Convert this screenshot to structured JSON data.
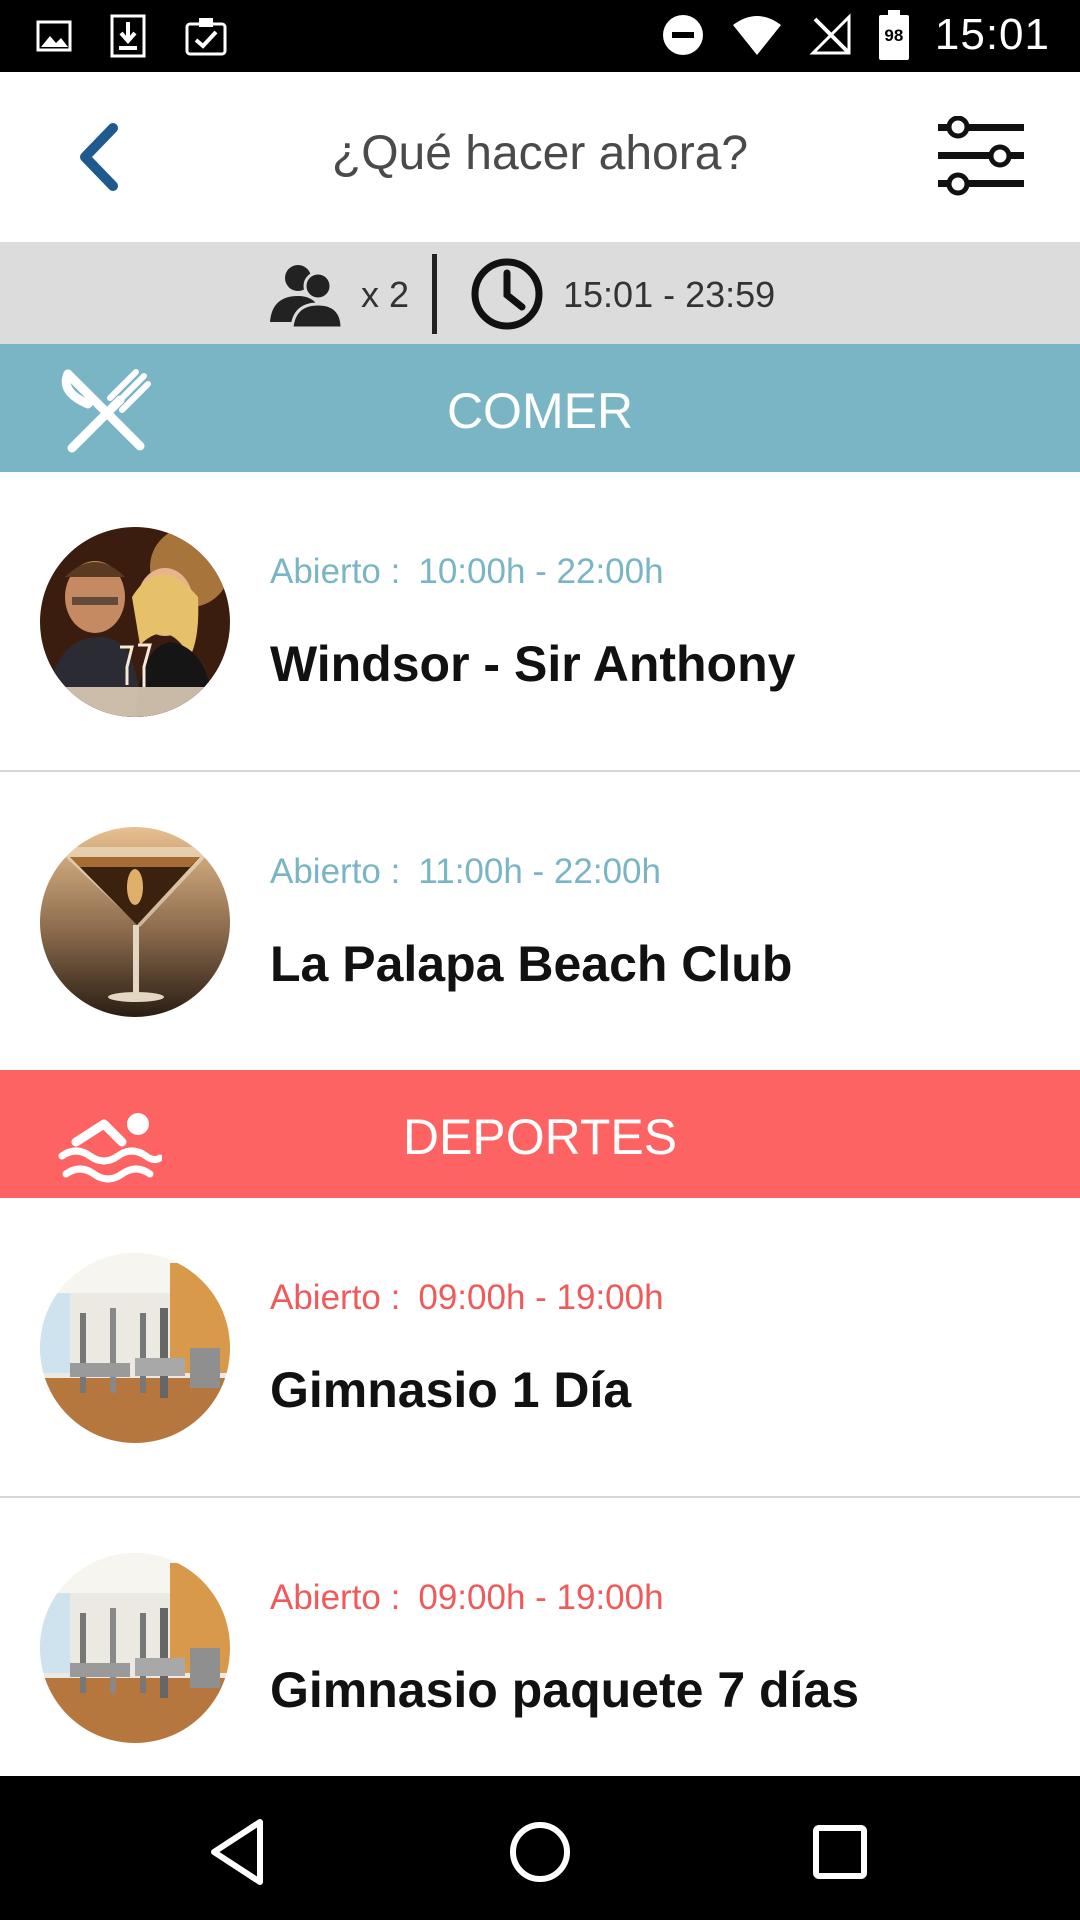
{
  "status_bar": {
    "time": "15:01",
    "battery_level": "98",
    "left_icons": [
      "image-icon",
      "download-icon",
      "clipboard-check-icon"
    ],
    "right_icons": [
      "do-not-disturb-icon",
      "wifi-icon",
      "no-signal-icon",
      "battery-icon"
    ]
  },
  "header": {
    "title": "¿Qué hacer ahora?",
    "back_icon": "chevron-left-icon",
    "filter_icon": "sliders-icon"
  },
  "info_bar": {
    "guests": "x 2",
    "time_range": "15:01 - 23:59"
  },
  "sections": [
    {
      "title": "COMER",
      "icon": "fork-knife-icon",
      "color": "#7ab5c6",
      "items": [
        {
          "hours_label": "Abierto :",
          "hours": "10:00h - 22:00h",
          "name": "Windsor - Sir Anthony",
          "image": "couple-dining-photo"
        },
        {
          "hours_label": "Abierto :",
          "hours": "11:00h - 22:00h",
          "name": "La Palapa Beach Club",
          "image": "cocktail-photo"
        }
      ]
    },
    {
      "title": "DEPORTES",
      "icon": "swimmer-icon",
      "color": "#fe6363",
      "items": [
        {
          "hours_label": "Abierto :",
          "hours": "09:00h - 19:00h",
          "name": "Gimnasio 1 Día",
          "image": "gym-photo"
        },
        {
          "hours_label": "Abierto :",
          "hours": "09:00h - 19:00h",
          "name": "Gimnasio paquete 7 días",
          "image": "gym-photo"
        }
      ]
    }
  ],
  "nav_bar": [
    "back-triangle-icon",
    "home-circle-icon",
    "recents-square-icon"
  ]
}
